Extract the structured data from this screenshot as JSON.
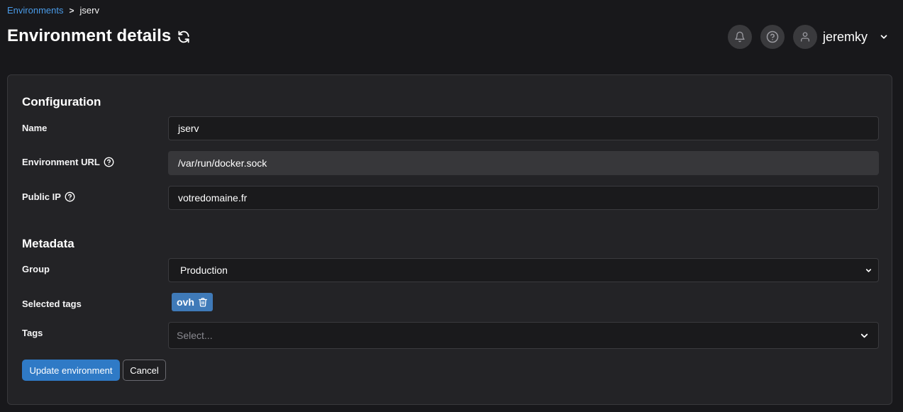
{
  "breadcrumb": {
    "parent": "Environments",
    "separator": ">",
    "current": "jserv"
  },
  "header": {
    "title": "Environment details",
    "username": "jeremky"
  },
  "configuration": {
    "title": "Configuration",
    "name_label": "Name",
    "name_value": "jserv",
    "url_label": "Environment URL",
    "url_value": "/var/run/docker.sock",
    "ip_label": "Public IP",
    "ip_value": "votredomaine.fr"
  },
  "metadata": {
    "title": "Metadata",
    "group_label": "Group",
    "group_value": "Production",
    "selected_tags_label": "Selected tags",
    "selected_tags": [
      "ovh"
    ],
    "tags_label": "Tags",
    "tags_placeholder": "Select..."
  },
  "actions": {
    "update_label": "Update environment",
    "cancel_label": "Cancel"
  },
  "colors": {
    "accent": "#2f7ac6",
    "link": "#4a9be8",
    "tag": "#3f7ab8",
    "background": "#18181b",
    "panel": "#232326"
  },
  "icons": [
    "refresh-icon",
    "bell-icon",
    "help-circle-icon",
    "user-icon",
    "chevron-down-icon",
    "trash-icon"
  ]
}
